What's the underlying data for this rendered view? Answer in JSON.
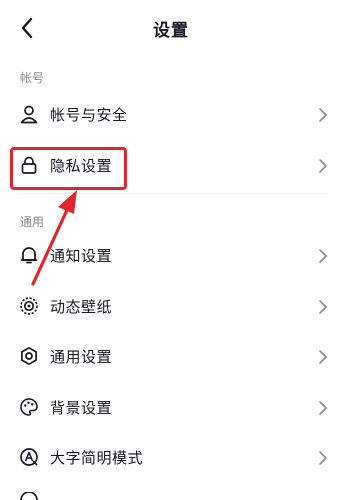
{
  "header": {
    "title": "设置"
  },
  "sections": {
    "account": "帐号",
    "general": "通用"
  },
  "rows": {
    "account_security": "帐号与安全",
    "privacy": "隐私设置",
    "notification": "通知设置",
    "wallpaper": "动态壁纸",
    "general": "通用设置",
    "background": "背景设置",
    "large_text": "大字简明模式"
  },
  "colors": {
    "annotation": "#e0262c",
    "text": "#161823",
    "muted": "#8a8b91"
  }
}
